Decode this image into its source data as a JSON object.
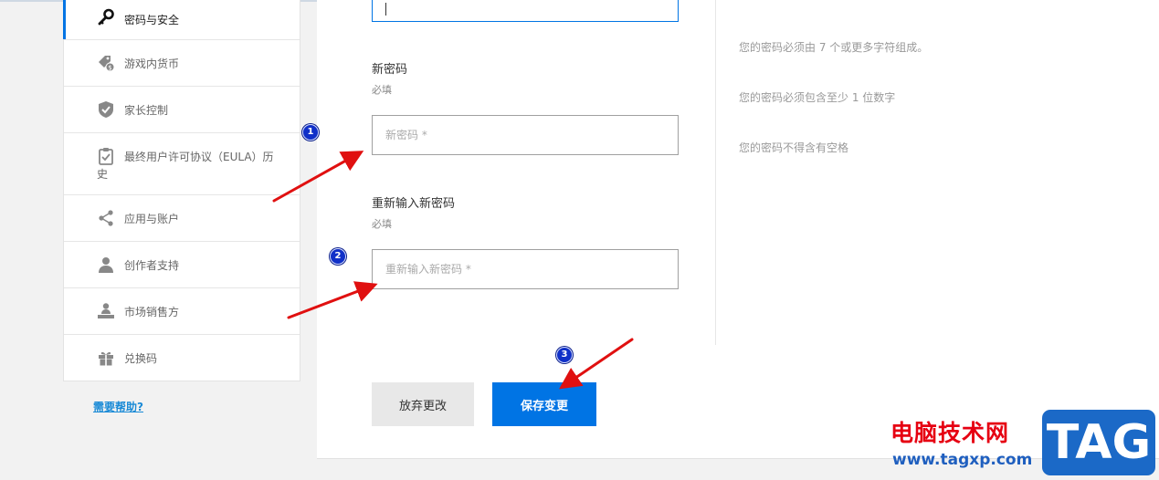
{
  "sidebar": {
    "items": [
      {
        "label": "密码与安全",
        "icon": "key-icon",
        "active": true
      },
      {
        "label": "游戏内货币",
        "icon": "coins-icon"
      },
      {
        "label": "家长控制",
        "icon": "shield-icon"
      },
      {
        "label": "最终用户许可协议（EULA）历史",
        "icon": "clipboard-check-icon"
      },
      {
        "label": "应用与账户",
        "icon": "share-icon"
      },
      {
        "label": "创作者支持",
        "icon": "user-icon"
      },
      {
        "label": "市场销售方",
        "icon": "seller-icon"
      },
      {
        "label": "兑换码",
        "icon": "gift-icon"
      }
    ],
    "help_link": "需要帮助?"
  },
  "form": {
    "new_password": {
      "label": "新密码",
      "hint": "必填",
      "placeholder": "新密码 *"
    },
    "confirm_password": {
      "label": "重新输入新密码",
      "hint": "必填",
      "placeholder": "重新输入新密码 *"
    }
  },
  "rules": [
    "您的密码必须由 7 个或更多字符组成。",
    "您的密码必须包含至少 1 位数字",
    "您的密码不得含有空格"
  ],
  "buttons": {
    "discard": "放弃更改",
    "save": "保存变更"
  },
  "annotations": {
    "badge1": "1",
    "badge2": "2",
    "badge3": "3",
    "arrow_color": "#e01010"
  },
  "watermark": {
    "title": "电脑技术网",
    "url": "www.tagxp.com",
    "tag": "TAG"
  },
  "colors": {
    "accent": "#0074e4",
    "background": "#f2f2f2"
  }
}
